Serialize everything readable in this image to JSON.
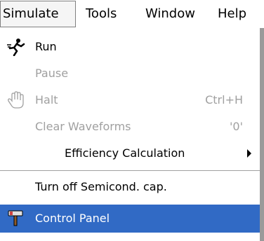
{
  "menubar": {
    "items": [
      {
        "label": "Simulate",
        "active": true
      },
      {
        "label": "Tools"
      },
      {
        "label": "Window"
      },
      {
        "label": "Help"
      }
    ]
  },
  "menu": {
    "items": [
      {
        "label": "Run",
        "enabled": true,
        "icon": "running-man-icon"
      },
      {
        "label": "Pause",
        "enabled": false
      },
      {
        "label": "Halt",
        "enabled": false,
        "shortcut": "Ctrl+H",
        "icon": "hand-icon"
      },
      {
        "label": "Clear Waveforms",
        "enabled": false,
        "shortcut": "'0'"
      },
      {
        "label": "Efficiency Calculation",
        "enabled": true,
        "submenu": true
      },
      {
        "label": "Turn off Semicond. cap.",
        "enabled": true
      },
      {
        "label": "Control Panel",
        "enabled": true,
        "highlighted": true,
        "icon": "hammer-icon"
      }
    ]
  },
  "colors": {
    "highlight": "#316ac5",
    "disabled_text": "#a0a0a0"
  }
}
